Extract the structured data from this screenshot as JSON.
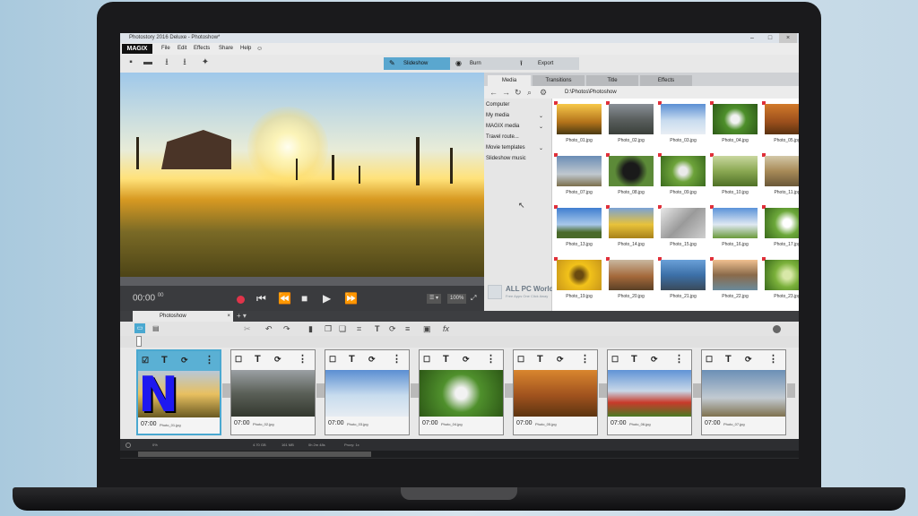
{
  "window": {
    "title": "Photostory 2016 Deluxe - Photoshow*"
  },
  "menubar": {
    "logo": "MAGIX",
    "items": [
      "File",
      "Edit",
      "Effects",
      "Share",
      "Help"
    ]
  },
  "modes": [
    {
      "label": "Slideshow",
      "icon": "pencil-icon",
      "active": true
    },
    {
      "label": "Burn",
      "icon": "disc-icon",
      "active": false
    },
    {
      "label": "Export",
      "icon": "upload-icon",
      "active": false
    }
  ],
  "transport": {
    "timecode": "00:00",
    "timecode_frames": "00",
    "zoom": "100%"
  },
  "media": {
    "tabs": [
      "Media",
      "Transitions",
      "Title",
      "Effects"
    ],
    "active_tab": "Media",
    "path": "D:\\Photos\\Photoshow",
    "tree": [
      {
        "label": "Computer",
        "expand": false
      },
      {
        "label": "My media",
        "expand": true
      },
      {
        "label": "MAGIX media",
        "expand": true
      },
      {
        "label": "Travel route...",
        "expand": false
      },
      {
        "label": "Movie templates",
        "expand": true
      },
      {
        "label": "Slideshow music",
        "expand": false
      }
    ],
    "watermark": {
      "title": "ALL PC World",
      "subtitle": "Free Apps One Click Away"
    },
    "photos": [
      {
        "name": "Photo_01.jpg",
        "bg": "linear-gradient(#f7c84a,#b3731a 60%,#4a3a12)"
      },
      {
        "name": "Photo_02.jpg",
        "bg": "linear-gradient(#8a9098,#5b605f 50%,#3a3f3a)"
      },
      {
        "name": "Photo_03.jpg",
        "bg": "linear-gradient(#5b8fd4,#c9dcef 55%,#e8eef4)"
      },
      {
        "name": "Photo_04.jpg",
        "bg": "radial-gradient(circle,#f2f2f2 15%,#4d8f2a 40%,#2e5a18)"
      },
      {
        "name": "Photo_05.jpg",
        "bg": "linear-gradient(#d27a2a,#9a4e1c 60%,#5a3210)"
      },
      {
        "name": "Photo_07.jpg",
        "bg": "linear-gradient(#6a8db5,#c0c8cf 60%,#7c6f4c)"
      },
      {
        "name": "Photo_08.jpg",
        "bg": "radial-gradient(circle,#1a1a1a 30%,#5c8a38 60%)"
      },
      {
        "name": "Photo_09.jpg",
        "bg": "radial-gradient(circle,#eaeaea 15%,#6da33a 40%,#3b6b1e)"
      },
      {
        "name": "Photo_10.jpg",
        "bg": "linear-gradient(#c9d7a0,#8aa852 50%,#4f7026)"
      },
      {
        "name": "Photo_11.jpg",
        "bg": "linear-gradient(#d3c8a8,#a88a58 50%,#6a5838)"
      },
      {
        "name": "Photo_13.jpg",
        "bg": "linear-gradient(#3f7ed0,#a8c8ea 55%,#4a6a2a 80%)"
      },
      {
        "name": "Photo_14.jpg",
        "bg": "linear-gradient(#7aa2d6,#e8c23a 55%,#a8821a)"
      },
      {
        "name": "Photo_15.jpg",
        "bg": "linear-gradient(135deg,#e8e8e8,#9a9a9a 50%,#cfcfcf)"
      },
      {
        "name": "Photo_16.jpg",
        "bg": "linear-gradient(#5a92d8,#dfe8f2 55%,#6a9a3a)"
      },
      {
        "name": "Photo_17.jpg",
        "bg": "radial-gradient(circle,#ffffff 15%,#6ca83a 45%,#3a6a1c)"
      },
      {
        "name": "Photo_19.jpg",
        "bg": "radial-gradient(circle,#6a4a10 15%,#f2c21a 40%,#c8961a)"
      },
      {
        "name": "Photo_20.jpg",
        "bg": "linear-gradient(#c9b8a0,#a4683a 55%,#5a4026)"
      },
      {
        "name": "Photo_21.jpg",
        "bg": "linear-gradient(#6aa0d8,#3c70a8 50%,#3a4a5a)"
      },
      {
        "name": "Photo_22.jpg",
        "bg": "linear-gradient(#f0c090,#8a6a4a 50%,#6a8a9a)"
      },
      {
        "name": "Photo_23.jpg",
        "bg": "radial-gradient(circle,#d8e8a8 15%,#7ab03a 45%,#3a6a1c)"
      }
    ]
  },
  "timeline": {
    "tab": "Photoshow",
    "clips": [
      {
        "time": "07:00",
        "name": "Photo_01.jpg",
        "selected": true,
        "bg": "linear-gradient(#b8c8d8,#e8c060 50%,#6a5a22)"
      },
      {
        "time": "07:00",
        "name": "Photo_02.jpg",
        "selected": false,
        "bg": "linear-gradient(#9ba0a4,#5b6058 50%,#33382f)"
      },
      {
        "time": "07:00",
        "name": "Photo_03.jpg",
        "selected": false,
        "bg": "linear-gradient(#5a8ed2,#c8dcee 55%,#e6ecf2)"
      },
      {
        "time": "07:00",
        "name": "Photo_04.jpg",
        "selected": false,
        "bg": "radial-gradient(circle,#f2f2f2 12%,#4f902c 40%,#2d5816)"
      },
      {
        "time": "07:00",
        "name": "Photo_05.jpg",
        "selected": false,
        "bg": "linear-gradient(#d9862e,#a0521e 55%,#5c3410)"
      },
      {
        "time": "07:00",
        "name": "Photo_06.jpg",
        "selected": false,
        "bg": "linear-gradient(#5f93d6,#c8d8e8 45%,#c83a2a 70%,#4a7a24)"
      },
      {
        "time": "07:00",
        "name": "Photo_07.jpg",
        "selected": false,
        "bg": "linear-gradient(#6b8fb6,#c2cad1 60%,#7e714e)"
      }
    ]
  },
  "statusbar": {
    "items": [
      "0%",
      "4.70 GB",
      "161 MB",
      "0h 2m 48s",
      "Proxy: 1x"
    ]
  }
}
